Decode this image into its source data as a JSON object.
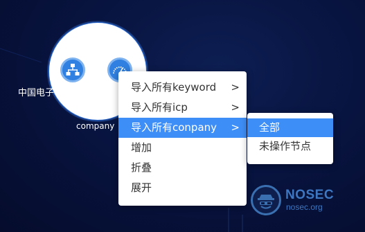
{
  "graph": {
    "node_label_left": "中国电子",
    "node_label_bottom": "company",
    "node_icons": [
      "org-chart-icon",
      "gauge-icon"
    ]
  },
  "context_menu": {
    "items": [
      {
        "label": "导入所有keyword",
        "has_submenu": true,
        "active": false
      },
      {
        "label": "导入所有icp",
        "has_submenu": true,
        "active": false
      },
      {
        "label": "导入所有conpany",
        "has_submenu": true,
        "active": true
      },
      {
        "label": "增加",
        "has_submenu": false,
        "active": false
      },
      {
        "label": "折叠",
        "has_submenu": false,
        "active": false
      },
      {
        "label": "展开",
        "has_submenu": false,
        "active": false
      }
    ],
    "chevron": ">"
  },
  "submenu": {
    "items": [
      {
        "label": "全部",
        "active": true
      },
      {
        "label": "未操作节点",
        "active": false
      }
    ]
  },
  "watermark": {
    "title": "NOSEC",
    "subtitle": "nosec.org"
  },
  "colors": {
    "background": "#081440",
    "menu_active": "#3e8ef7",
    "node_icon": "#2f80e0",
    "watermark": "#3d77c2"
  }
}
